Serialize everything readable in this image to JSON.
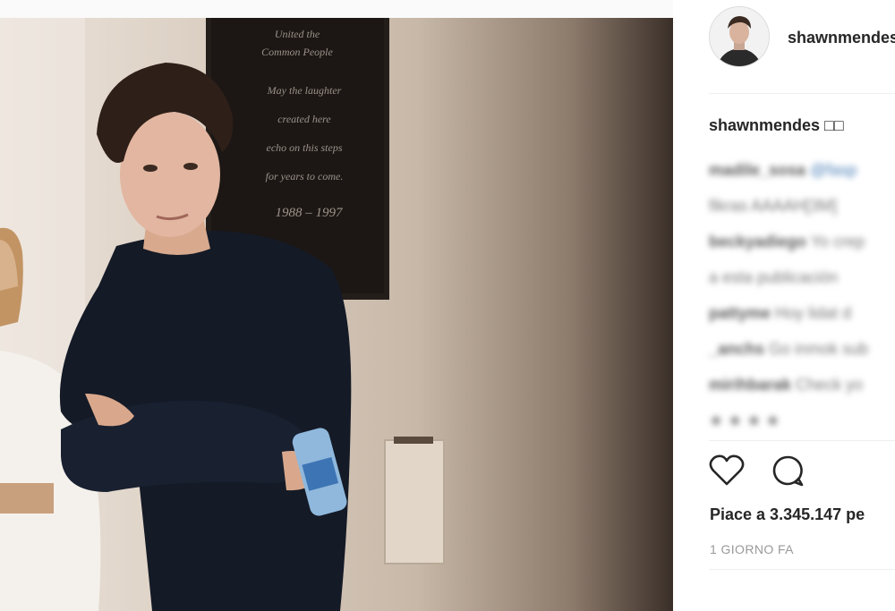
{
  "post": {
    "username": "shawnmendes",
    "caption_user": "shawnmendes",
    "caption_text": " □□",
    "likes_text": "Piace a 3.345.147 pe",
    "time_text": "1 GIORNO FA",
    "plaque_lines": [
      "United the",
      "Common People",
      "May the laughter",
      "created here",
      "echo on this steps",
      "for years to come.",
      "1988 – 1997"
    ]
  },
  "comments": [
    {
      "user": "madile_sosa",
      "text": " @fasp"
    },
    {
      "user": "",
      "text": "fikras AAAAH[3M]"
    },
    {
      "user": "beckyadiego",
      "text": " Yo crep"
    },
    {
      "user": "",
      "text": "a esta publicación"
    },
    {
      "user": "pattyme",
      "text": " Hoy lidat d"
    },
    {
      "user": "_anchs",
      "text": " Go inmok sub"
    },
    {
      "user": "mirihbarak",
      "text": " Check yo"
    },
    {
      "user": "",
      "text": "★ ★ ★ ★ "
    }
  ],
  "icons": {
    "like": "heart-outline-icon",
    "comment": "speech-bubble-icon"
  },
  "colors": {
    "text": "#262626",
    "muted": "#999999",
    "divider": "#efefef",
    "mention": "#4a7fb8"
  }
}
